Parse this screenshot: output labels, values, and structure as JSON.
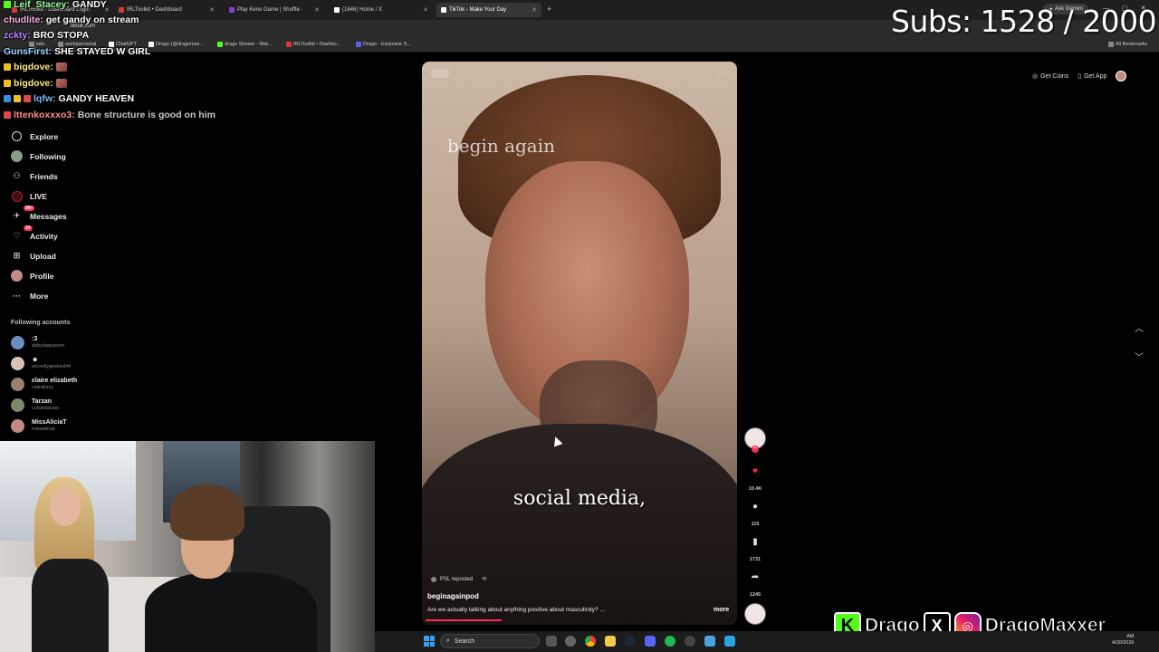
{
  "browser": {
    "tabs": [
      {
        "label": "IRLToolkit - Dashboard Login",
        "color": "#d33a3a",
        "active": false
      },
      {
        "label": "IRLToolkit • Dashboard",
        "color": "#d33a3a",
        "active": false
      },
      {
        "label": "Play Keno Game | Shuffle ·",
        "color": "#8a3fd1",
        "active": false
      },
      {
        "label": "(1646) Home / X",
        "color": "#ffffff",
        "active": false
      },
      {
        "label": "TikTok - Make Your Day",
        "color": "#ffffff",
        "active": true
      }
    ],
    "ask_gemini": "Ask Gemini",
    "url": "tiktok.com",
    "bookmarks": [
      {
        "label": "edu",
        "color": "#888888"
      },
      {
        "label": "work/personal",
        "color": "#888888"
      },
      {
        "label": "ChatGPT",
        "color": "#ffffff"
      },
      {
        "label": "Drago (@dragomax...",
        "color": "#ffffff"
      },
      {
        "label": "drago Stream - Wat...",
        "color": "#53fc18"
      },
      {
        "label": "IRLToolkit • Dashbo...",
        "color": "#d33a3a"
      },
      {
        "label": "Drago - Exclusive S...",
        "color": "#5865f2"
      }
    ],
    "all_bookmarks": "All Bookmarks"
  },
  "overlay": {
    "subs": "Subs: 1528 / 2000",
    "chat": [
      {
        "user": "Leif_Stacey:",
        "user_color": "#9aff9a",
        "text": "GANDY",
        "emote": false
      },
      {
        "user": "chudlite:",
        "user_color": "#ffb3e6",
        "text": "get gandy on stream",
        "emote": false
      },
      {
        "user": "zckty:",
        "user_color": "#b58cff",
        "text": "BRO STOPA",
        "emote": false
      },
      {
        "user": "GunsFirst:",
        "user_color": "#9ad6ff",
        "text": "SHE STAYED W GIRL",
        "emote": false
      },
      {
        "user": "bigdove:",
        "user_color": "#ffe680",
        "text": "",
        "emote": true
      },
      {
        "user": "bigdove:",
        "user_color": "#ffe680",
        "text": "",
        "emote": true
      },
      {
        "user": "lqfw:",
        "user_color": "#7fb2ff",
        "text": "GANDY HEAVEN",
        "emote": false
      },
      {
        "user": "lttenkoxxxo3:",
        "user_color": "#ff8a8a",
        "text": "Bone structure is good on him",
        "emote": false
      }
    ]
  },
  "tiktok": {
    "nav": [
      {
        "label": "Explore",
        "icon": "compass-icon"
      },
      {
        "label": "Following",
        "icon": "following-avatar-icon"
      },
      {
        "label": "Friends",
        "icon": "friends-icon"
      },
      {
        "label": "LIVE",
        "icon": "live-icon"
      },
      {
        "label": "Messages",
        "icon": "messages-icon",
        "badge": "99+"
      },
      {
        "label": "Activity",
        "icon": "activity-icon",
        "badge": "24"
      },
      {
        "label": "Upload",
        "icon": "upload-icon"
      },
      {
        "label": "Profile",
        "icon": "profile-avatar-icon"
      },
      {
        "label": "More",
        "icon": "more-icon"
      }
    ],
    "following_title": "Following accounts",
    "accounts": [
      {
        "name": ":3",
        "handle": "abbydaqueenn",
        "color": "#6a8fbf"
      },
      {
        "name": "",
        "handle": "secretlygeeked44",
        "color": "#d7c2b8"
      },
      {
        "name": "claire elizabeth",
        "handle": "clairalizzy",
        "color": "#9a7f73"
      },
      {
        "name": "Tarzan",
        "handle": "cubantarzan",
        "color": "#7d8a6a"
      },
      {
        "name": "MissAliciaT",
        "handle": "missaliciat",
        "color": "#c48a86"
      }
    ],
    "top_right": {
      "coins": "Get Coins",
      "app": "Get App"
    },
    "video": {
      "watermark": "begin again",
      "subtitle": "social media,",
      "repost": "PSL reposted",
      "author": "beginagainpod",
      "description": "Are we actually talking about anything positive about masculinity? ...",
      "more": "more",
      "progress": 0.24
    },
    "actions": {
      "likes": "10.4K",
      "comments": "115",
      "saves": "1731",
      "shares": "1245"
    }
  },
  "social": {
    "kick": "Drago",
    "instagram": "DragoMaxxer",
    "colors": {
      "kick": "#53fc18"
    }
  },
  "taskbar": {
    "search": "Search",
    "time": "AM",
    "date": "4/30/2026"
  }
}
